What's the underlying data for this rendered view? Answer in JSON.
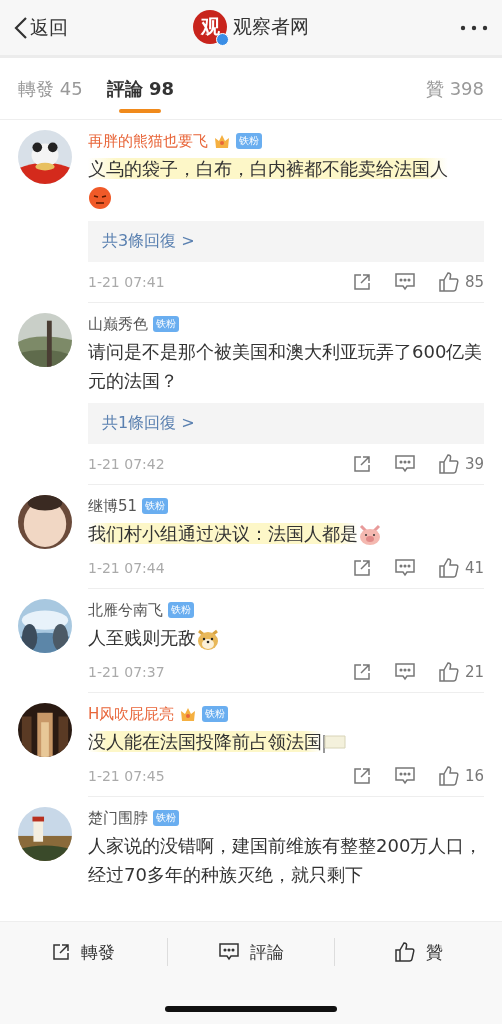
{
  "nav": {
    "back_label": "返回",
    "logo_text": "观",
    "title": "观察者网"
  },
  "tabs": [
    {
      "label": "轉發 45",
      "selected": false
    },
    {
      "label": "評論 98",
      "selected": true
    },
    {
      "label": "贊 398",
      "selected": false
    }
  ],
  "comments": [
    {
      "name": "再胖的熊猫也要飞",
      "crown": true,
      "badge": "铁粉",
      "text": "义乌的袋子，白布，白内裤都不能卖给法国人",
      "highlighted": true,
      "replies": "共3條回復 >",
      "time": "1-21 07:41",
      "likes": "85"
    },
    {
      "name": "山巅秀色",
      "crown": false,
      "badge": "铁粉",
      "text": "请问是不是那个被美国和澳大利亚玩弄了600亿美元的法国？",
      "highlighted": false,
      "replies": "共1條回復 >",
      "time": "1-21 07:42",
      "likes": "39"
    },
    {
      "name": "继博51",
      "crown": false,
      "badge": "铁粉",
      "text": "我们村小组通过决议：法国人都是",
      "highlighted": true,
      "time": "1-21 07:44",
      "likes": "41"
    },
    {
      "name": "北雁兮南飞",
      "crown": false,
      "badge": "铁粉",
      "text": "人至贱则无敌",
      "highlighted": false,
      "time": "1-21 07:37",
      "likes": "21"
    },
    {
      "name": "H风吹屁屁亮",
      "crown": true,
      "badge": "铁粉",
      "text": "没人能在法国投降前占领法国",
      "highlighted": true,
      "time": "1-21 07:45",
      "likes": "16"
    },
    {
      "name": "楚门围脖",
      "crown": false,
      "badge": "铁粉",
      "text": "人家说的没错啊，建国前维族有整整200万人口，经过70多年的种族灭绝，就只剩下",
      "highlighted": false
    }
  ],
  "bottom_bar": [
    {
      "label": "轉發"
    },
    {
      "label": "評論"
    },
    {
      "label": "贊"
    }
  ]
}
